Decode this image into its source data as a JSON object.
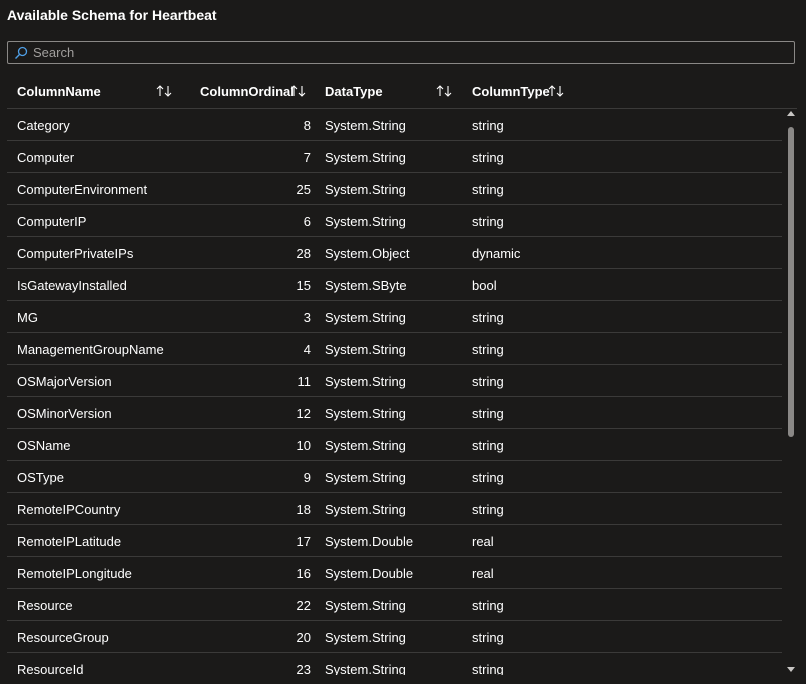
{
  "title": "Available Schema for Heartbeat",
  "search": {
    "placeholder": "Search",
    "value": ""
  },
  "columns": [
    {
      "label": "ColumnName"
    },
    {
      "label": "ColumnOrdinal"
    },
    {
      "label": "DataType"
    },
    {
      "label": "ColumnType"
    }
  ],
  "rows": [
    {
      "name": "Category",
      "ordinal": "8",
      "datatype": "System.String",
      "coltype": "string"
    },
    {
      "name": "Computer",
      "ordinal": "7",
      "datatype": "System.String",
      "coltype": "string"
    },
    {
      "name": "ComputerEnvironment",
      "ordinal": "25",
      "datatype": "System.String",
      "coltype": "string"
    },
    {
      "name": "ComputerIP",
      "ordinal": "6",
      "datatype": "System.String",
      "coltype": "string"
    },
    {
      "name": "ComputerPrivateIPs",
      "ordinal": "28",
      "datatype": "System.Object",
      "coltype": "dynamic"
    },
    {
      "name": "IsGatewayInstalled",
      "ordinal": "15",
      "datatype": "System.SByte",
      "coltype": "bool"
    },
    {
      "name": "MG",
      "ordinal": "3",
      "datatype": "System.String",
      "coltype": "string"
    },
    {
      "name": "ManagementGroupName",
      "ordinal": "4",
      "datatype": "System.String",
      "coltype": "string"
    },
    {
      "name": "OSMajorVersion",
      "ordinal": "11",
      "datatype": "System.String",
      "coltype": "string"
    },
    {
      "name": "OSMinorVersion",
      "ordinal": "12",
      "datatype": "System.String",
      "coltype": "string"
    },
    {
      "name": "OSName",
      "ordinal": "10",
      "datatype": "System.String",
      "coltype": "string"
    },
    {
      "name": "OSType",
      "ordinal": "9",
      "datatype": "System.String",
      "coltype": "string"
    },
    {
      "name": "RemoteIPCountry",
      "ordinal": "18",
      "datatype": "System.String",
      "coltype": "string"
    },
    {
      "name": "RemoteIPLatitude",
      "ordinal": "17",
      "datatype": "System.Double",
      "coltype": "real"
    },
    {
      "name": "RemoteIPLongitude",
      "ordinal": "16",
      "datatype": "System.Double",
      "coltype": "real"
    },
    {
      "name": "Resource",
      "ordinal": "22",
      "datatype": "System.String",
      "coltype": "string"
    },
    {
      "name": "ResourceGroup",
      "ordinal": "20",
      "datatype": "System.String",
      "coltype": "string"
    },
    {
      "name": "ResourceId",
      "ordinal": "23",
      "datatype": "System.String",
      "coltype": "string"
    }
  ],
  "icons": {
    "search": "search-icon",
    "sort": "sort-arrows-icon",
    "scroll_up": "scroll-up-icon",
    "scroll_down": "scroll-down-icon"
  },
  "colors": {
    "background": "#1b1a19",
    "border": "#3b3a39",
    "search_border": "#8a8886",
    "search_icon": "#4f9fe6"
  }
}
